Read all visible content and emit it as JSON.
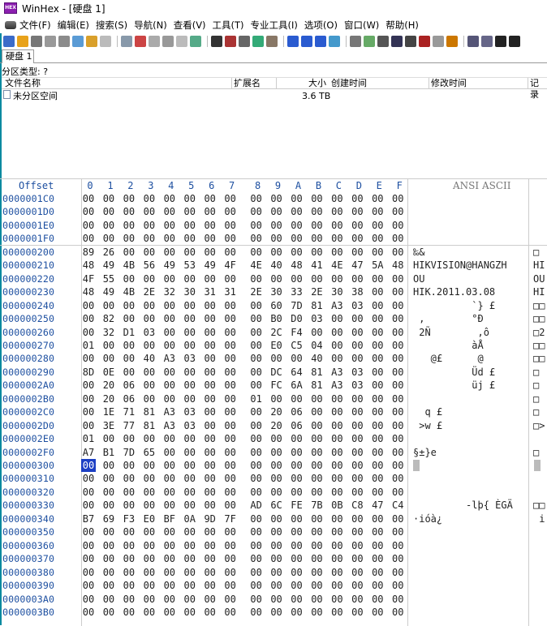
{
  "window": {
    "title": "WinHex - [硬盘 1]",
    "app_icon_label": "HEX"
  },
  "menu": [
    "文件(F)",
    "编辑(E)",
    "搜索(S)",
    "导航(N)",
    "查看(V)",
    "工具(T)",
    "专业工具(I)",
    "选项(O)",
    "窗口(W)",
    "帮助(H)"
  ],
  "tabs": [
    {
      "label": "硬盘 1"
    }
  ],
  "partition_type": "分区类型: ?",
  "list": {
    "headers": [
      "文件名称",
      "扩展名",
      "大小",
      "创建时间",
      "修改时间",
      "记录"
    ],
    "rows": [
      {
        "name": "未分区空间",
        "ext": "",
        "size": "3.6 TB",
        "created": "",
        "modified": ""
      }
    ]
  },
  "hex": {
    "offset_header": "Offset",
    "columns": [
      "0",
      "1",
      "2",
      "3",
      "4",
      "5",
      "6",
      "7",
      "8",
      "9",
      "A",
      "B",
      "C",
      "D",
      "E",
      "F"
    ],
    "ascii_header": "ANSI ASCII",
    "rows": [
      {
        "offset": "0000001C0",
        "bytes": [
          "00",
          "00",
          "00",
          "00",
          "00",
          "00",
          "00",
          "00",
          "00",
          "00",
          "00",
          "00",
          "00",
          "00",
          "00",
          "00"
        ],
        "ascii": "",
        "ascii2": ""
      },
      {
        "offset": "0000001D0",
        "bytes": [
          "00",
          "00",
          "00",
          "00",
          "00",
          "00",
          "00",
          "00",
          "00",
          "00",
          "00",
          "00",
          "00",
          "00",
          "00",
          "00"
        ],
        "ascii": "",
        "ascii2": ""
      },
      {
        "offset": "0000001E0",
        "bytes": [
          "00",
          "00",
          "00",
          "00",
          "00",
          "00",
          "00",
          "00",
          "00",
          "00",
          "00",
          "00",
          "00",
          "00",
          "00",
          "00"
        ],
        "ascii": "",
        "ascii2": ""
      },
      {
        "offset": "0000001F0",
        "bytes": [
          "00",
          "00",
          "00",
          "00",
          "00",
          "00",
          "00",
          "00",
          "00",
          "00",
          "00",
          "00",
          "00",
          "00",
          "00",
          "00"
        ],
        "ascii": "",
        "ascii2": ""
      },
      {
        "offset": "000000200",
        "bytes": [
          "89",
          "26",
          "00",
          "00",
          "00",
          "00",
          "00",
          "00",
          "00",
          "00",
          "00",
          "00",
          "00",
          "00",
          "00",
          "00"
        ],
        "ascii": "‰&",
        "ascii2": "□"
      },
      {
        "offset": "000000210",
        "bytes": [
          "48",
          "49",
          "4B",
          "56",
          "49",
          "53",
          "49",
          "4F",
          "4E",
          "40",
          "48",
          "41",
          "4E",
          "47",
          "5A",
          "48"
        ],
        "ascii": "HIKVISION@HANGZH",
        "ascii2": "HI"
      },
      {
        "offset": "000000220",
        "bytes": [
          "4F",
          "55",
          "00",
          "00",
          "00",
          "00",
          "00",
          "00",
          "00",
          "00",
          "00",
          "00",
          "00",
          "00",
          "00",
          "00"
        ],
        "ascii": "OU",
        "ascii2": "OU"
      },
      {
        "offset": "000000230",
        "bytes": [
          "48",
          "49",
          "4B",
          "2E",
          "32",
          "30",
          "31",
          "31",
          "2E",
          "30",
          "33",
          "2E",
          "30",
          "38",
          "00",
          "00"
        ],
        "ascii": "HIK.2011.03.08",
        "ascii2": "HI"
      },
      {
        "offset": "000000240",
        "bytes": [
          "00",
          "00",
          "00",
          "00",
          "00",
          "00",
          "00",
          "00",
          "00",
          "60",
          "7D",
          "81",
          "A3",
          "03",
          "00",
          "00"
        ],
        "ascii": "          `} £",
        "ascii2": "□□"
      },
      {
        "offset": "000000250",
        "bytes": [
          "00",
          "82",
          "00",
          "00",
          "00",
          "00",
          "00",
          "00",
          "00",
          "B0",
          "D0",
          "03",
          "00",
          "00",
          "00",
          "00"
        ],
        "ascii": " ‚        °Ð",
        "ascii2": "□□"
      },
      {
        "offset": "000000260",
        "bytes": [
          "00",
          "32",
          "D1",
          "03",
          "00",
          "00",
          "00",
          "00",
          "00",
          "2C",
          "F4",
          "00",
          "00",
          "00",
          "00",
          "00"
        ],
        "ascii": " 2Ñ        ,ô",
        "ascii2": "□2"
      },
      {
        "offset": "000000270",
        "bytes": [
          "01",
          "00",
          "00",
          "00",
          "00",
          "00",
          "00",
          "00",
          "00",
          "E0",
          "C5",
          "04",
          "00",
          "00",
          "00",
          "00"
        ],
        "ascii": "          àÅ",
        "ascii2": "□□"
      },
      {
        "offset": "000000280",
        "bytes": [
          "00",
          "00",
          "00",
          "40",
          "A3",
          "03",
          "00",
          "00",
          "00",
          "00",
          "00",
          "40",
          "00",
          "00",
          "00",
          "00"
        ],
        "ascii": "   @£      @",
        "ascii2": "□□"
      },
      {
        "offset": "000000290",
        "bytes": [
          "8D",
          "0E",
          "00",
          "00",
          "00",
          "00",
          "00",
          "00",
          "00",
          "DC",
          "64",
          "81",
          "A3",
          "03",
          "00",
          "00"
        ],
        "ascii": "          Üd £",
        "ascii2": "□"
      },
      {
        "offset": "0000002A0",
        "bytes": [
          "00",
          "20",
          "06",
          "00",
          "00",
          "00",
          "00",
          "00",
          "00",
          "FC",
          "6A",
          "81",
          "A3",
          "03",
          "00",
          "00"
        ],
        "ascii": "          üj £",
        "ascii2": "□"
      },
      {
        "offset": "0000002B0",
        "bytes": [
          "00",
          "20",
          "06",
          "00",
          "00",
          "00",
          "00",
          "00",
          "01",
          "00",
          "00",
          "00",
          "00",
          "00",
          "00",
          "00"
        ],
        "ascii": "",
        "ascii2": "□"
      },
      {
        "offset": "0000002C0",
        "bytes": [
          "00",
          "1E",
          "71",
          "81",
          "A3",
          "03",
          "00",
          "00",
          "00",
          "20",
          "06",
          "00",
          "00",
          "00",
          "00",
          "00"
        ],
        "ascii": "  q £",
        "ascii2": "□"
      },
      {
        "offset": "0000002D0",
        "bytes": [
          "00",
          "3E",
          "77",
          "81",
          "A3",
          "03",
          "00",
          "00",
          "00",
          "20",
          "06",
          "00",
          "00",
          "00",
          "00",
          "00"
        ],
        "ascii": " >w £",
        "ascii2": "□>"
      },
      {
        "offset": "0000002E0",
        "bytes": [
          "01",
          "00",
          "00",
          "00",
          "00",
          "00",
          "00",
          "00",
          "00",
          "00",
          "00",
          "00",
          "00",
          "00",
          "00",
          "00"
        ],
        "ascii": "",
        "ascii2": ""
      },
      {
        "offset": "0000002F0",
        "bytes": [
          "A7",
          "B1",
          "7D",
          "65",
          "00",
          "00",
          "00",
          "00",
          "00",
          "00",
          "00",
          "00",
          "00",
          "00",
          "00",
          "00"
        ],
        "ascii": "§±}e",
        "ascii2": "□"
      },
      {
        "offset": "000000300",
        "bytes": [
          "00",
          "00",
          "00",
          "00",
          "00",
          "00",
          "00",
          "00",
          "00",
          "00",
          "00",
          "00",
          "00",
          "00",
          "00",
          "00"
        ],
        "ascii": "",
        "ascii2": ""
      },
      {
        "offset": "000000310",
        "bytes": [
          "00",
          "00",
          "00",
          "00",
          "00",
          "00",
          "00",
          "00",
          "00",
          "00",
          "00",
          "00",
          "00",
          "00",
          "00",
          "00"
        ],
        "ascii": "",
        "ascii2": ""
      },
      {
        "offset": "000000320",
        "bytes": [
          "00",
          "00",
          "00",
          "00",
          "00",
          "00",
          "00",
          "00",
          "00",
          "00",
          "00",
          "00",
          "00",
          "00",
          "00",
          "00"
        ],
        "ascii": "",
        "ascii2": ""
      },
      {
        "offset": "000000330",
        "bytes": [
          "00",
          "00",
          "00",
          "00",
          "00",
          "00",
          "00",
          "00",
          "AD",
          "6C",
          "FE",
          "7B",
          "0B",
          "C8",
          "47",
          "C4"
        ],
        "ascii": "         -lþ{ ÈGÄ",
        "ascii2": "□□"
      },
      {
        "offset": "000000340",
        "bytes": [
          "B7",
          "69",
          "F3",
          "E0",
          "BF",
          "0A",
          "9D",
          "7F",
          "00",
          "00",
          "00",
          "00",
          "00",
          "00",
          "00",
          "00"
        ],
        "ascii": "·ióà¿",
        "ascii2": " i"
      },
      {
        "offset": "000000350",
        "bytes": [
          "00",
          "00",
          "00",
          "00",
          "00",
          "00",
          "00",
          "00",
          "00",
          "00",
          "00",
          "00",
          "00",
          "00",
          "00",
          "00"
        ],
        "ascii": "",
        "ascii2": ""
      },
      {
        "offset": "000000360",
        "bytes": [
          "00",
          "00",
          "00",
          "00",
          "00",
          "00",
          "00",
          "00",
          "00",
          "00",
          "00",
          "00",
          "00",
          "00",
          "00",
          "00"
        ],
        "ascii": "",
        "ascii2": ""
      },
      {
        "offset": "000000370",
        "bytes": [
          "00",
          "00",
          "00",
          "00",
          "00",
          "00",
          "00",
          "00",
          "00",
          "00",
          "00",
          "00",
          "00",
          "00",
          "00",
          "00"
        ],
        "ascii": "",
        "ascii2": ""
      },
      {
        "offset": "000000380",
        "bytes": [
          "00",
          "00",
          "00",
          "00",
          "00",
          "00",
          "00",
          "00",
          "00",
          "00",
          "00",
          "00",
          "00",
          "00",
          "00",
          "00"
        ],
        "ascii": "",
        "ascii2": ""
      },
      {
        "offset": "000000390",
        "bytes": [
          "00",
          "00",
          "00",
          "00",
          "00",
          "00",
          "00",
          "00",
          "00",
          "00",
          "00",
          "00",
          "00",
          "00",
          "00",
          "00"
        ],
        "ascii": "",
        "ascii2": ""
      },
      {
        "offset": "0000003A0",
        "bytes": [
          "00",
          "00",
          "00",
          "00",
          "00",
          "00",
          "00",
          "00",
          "00",
          "00",
          "00",
          "00",
          "00",
          "00",
          "00",
          "00"
        ],
        "ascii": "",
        "ascii2": ""
      },
      {
        "offset": "0000003B0",
        "bytes": [
          "00",
          "00",
          "00",
          "00",
          "00",
          "00",
          "00",
          "00",
          "00",
          "00",
          "00",
          "00",
          "00",
          "00",
          "00",
          "00"
        ],
        "ascii": "",
        "ascii2": ""
      }
    ]
  }
}
